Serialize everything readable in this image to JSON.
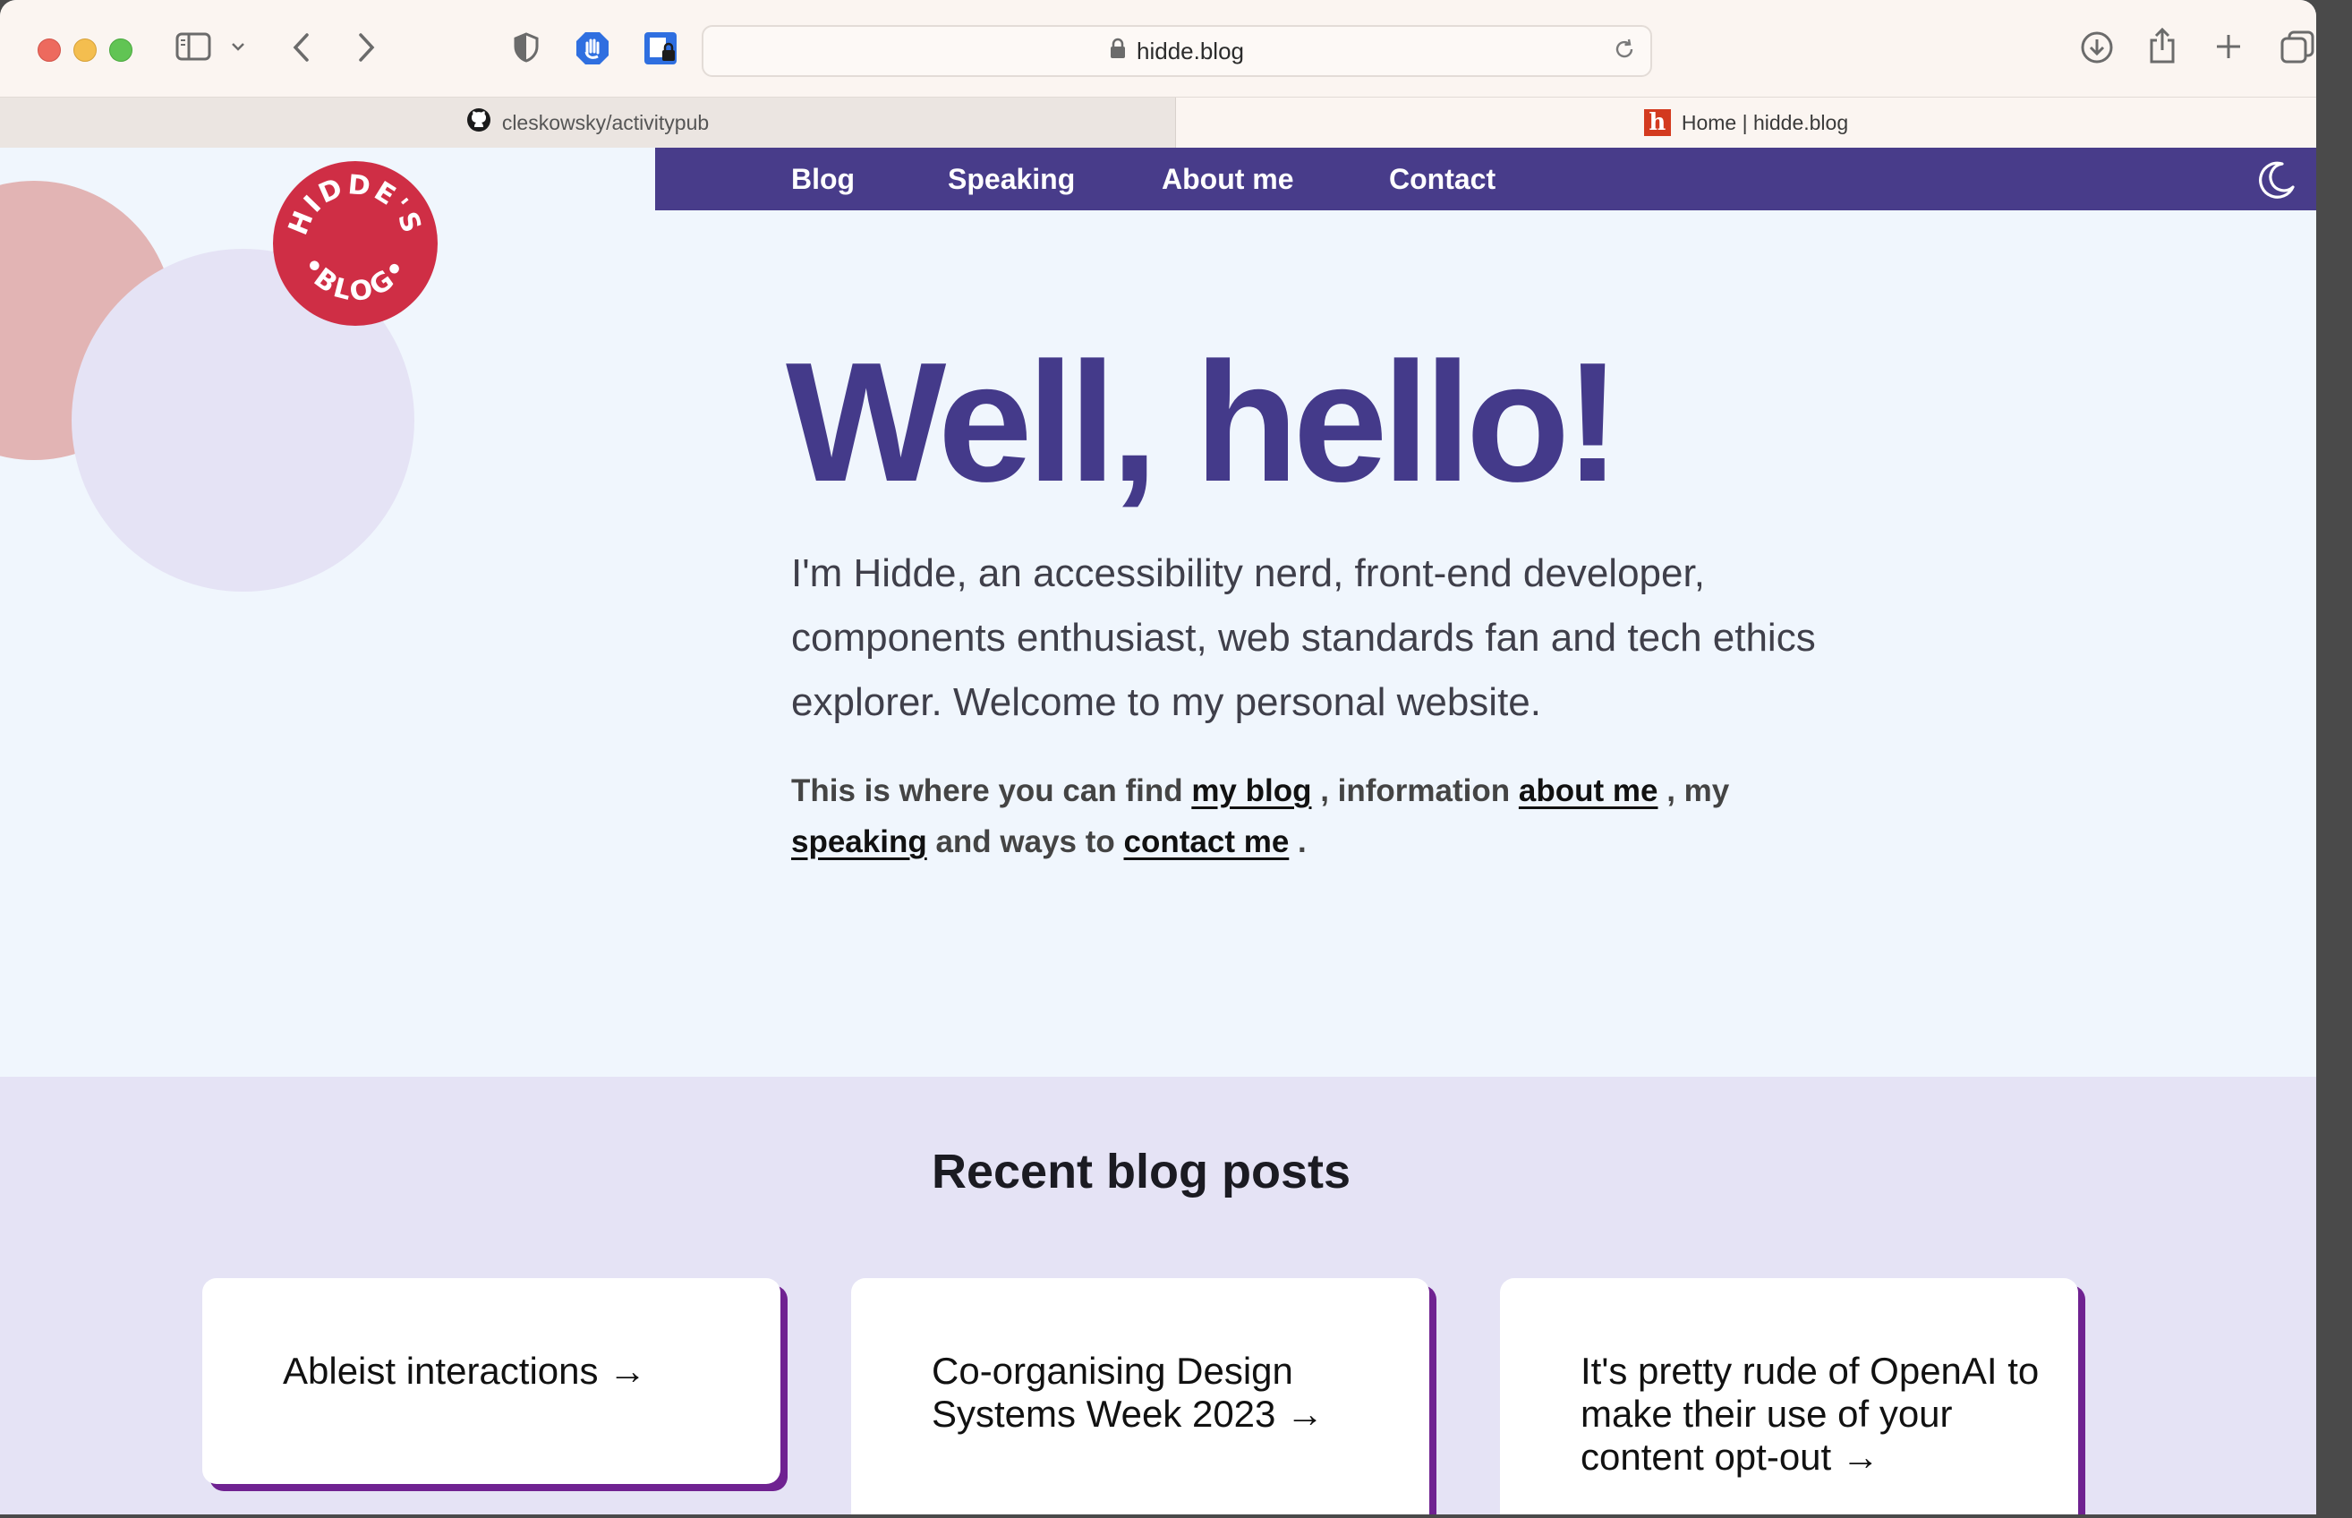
{
  "browser": {
    "url": "hidde.blog",
    "tabs": [
      {
        "label": "cleskowsky/activitypub",
        "icon": "github-icon"
      },
      {
        "label": "Home | hidde.blog",
        "icon": "hidde-favicon"
      }
    ]
  },
  "site": {
    "logo_text": "HIDDE'S BLOG",
    "nav": [
      "Blog",
      "Speaking",
      "About me",
      "Contact"
    ],
    "hero": {
      "title": "Well, hello!",
      "intro": "I'm Hidde, an accessibility nerd, front-end developer, components enthusiast, web standards fan and tech ethics explorer. Welcome to my personal website.",
      "links_part1": "This is where you can find ",
      "link_blog": "my blog",
      "links_part2": " , information ",
      "link_about": "about me",
      "links_part3": " , my ",
      "link_speaking": "speaking",
      "links_part4": " and ways to ",
      "link_contact": "contact me",
      "links_part5": " ."
    },
    "recent": {
      "title": "Recent blog posts",
      "posts": [
        "Ableist interactions →",
        "Co-organising Design Systems Week 2023 →",
        "It's pretty rude of OpenAI to make their use of your content opt-out →"
      ]
    }
  },
  "colors": {
    "nav_bg": "#483c8a",
    "title": "#443a8a",
    "card_shadow": "#6f2291",
    "recent_bg": "#e5e3f5",
    "logo_red": "#cf2e45"
  }
}
